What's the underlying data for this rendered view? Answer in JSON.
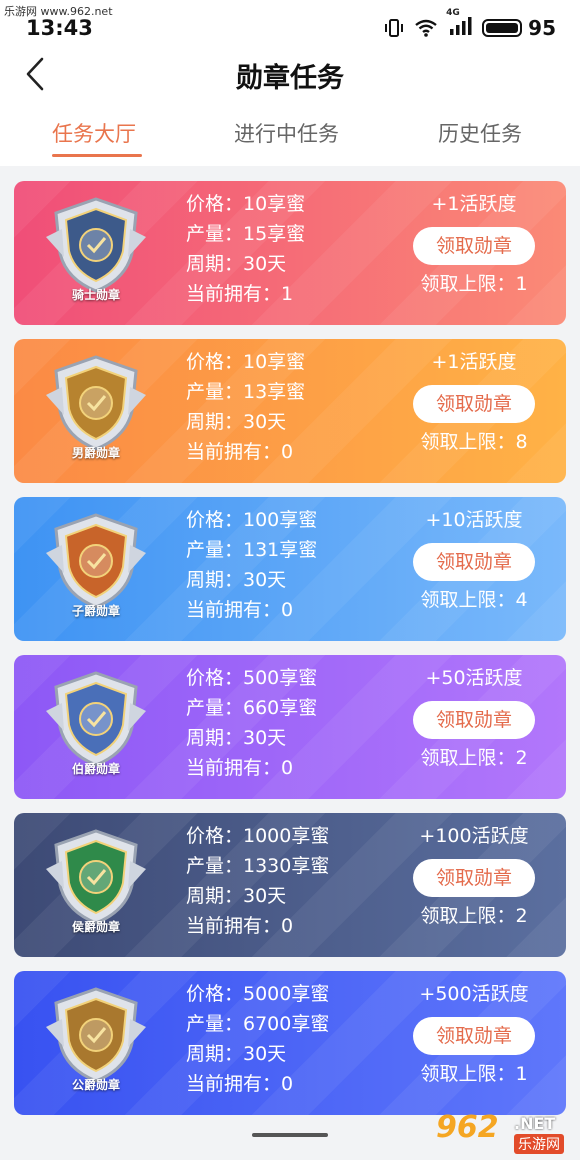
{
  "watermark": {
    "site": "乐游网 www.962.net",
    "logo_num": "962",
    "logo_net": ".NET",
    "logo_cn": "乐游网"
  },
  "status": {
    "time": "13:43",
    "battery": "95",
    "network": "4G"
  },
  "header": {
    "title": "勋章任务"
  },
  "tabs": [
    {
      "label": "任务大厅",
      "active": true
    },
    {
      "label": "进行中任务",
      "active": false
    },
    {
      "label": "历史任务",
      "active": false
    }
  ],
  "medals": [
    {
      "name": "骑士勋章",
      "price": "价格：10享蜜",
      "output": "产量：15享蜜",
      "period": "周期：30天",
      "owned": "当前拥有：1",
      "activity": "+1活跃度",
      "button": "领取勋章",
      "limit": "领取上限：1",
      "colors": [
        "#f04e78",
        "#fb8a76"
      ],
      "shield": "#3d5a8a"
    },
    {
      "name": "男爵勋章",
      "price": "价格：10享蜜",
      "output": "产量：13享蜜",
      "period": "周期：30天",
      "owned": "当前拥有：0",
      "activity": "+1活跃度",
      "button": "领取勋章",
      "limit": "领取上限：8",
      "colors": [
        "#fb8a45",
        "#ffb246"
      ],
      "shield": "#b7832f"
    },
    {
      "name": "子爵勋章",
      "price": "价格：100享蜜",
      "output": "产量：131享蜜",
      "period": "周期：30天",
      "owned": "当前拥有：0",
      "activity": "+10活跃度",
      "button": "领取勋章",
      "limit": "领取上限：4",
      "colors": [
        "#3e93f3",
        "#7ab9fb"
      ],
      "shield": "#c8642a"
    },
    {
      "name": "伯爵勋章",
      "price": "价格：500享蜜",
      "output": "产量：660享蜜",
      "period": "周期：30天",
      "owned": "当前拥有：0",
      "activity": "+50活跃度",
      "button": "领取勋章",
      "limit": "领取上限：2",
      "colors": [
        "#8d58f6",
        "#b277fb"
      ],
      "shield": "#4a6fb8"
    },
    {
      "name": "侯爵勋章",
      "price": "价格：1000享蜜",
      "output": "产量：1330享蜜",
      "period": "周期：30天",
      "owned": "当前拥有：0",
      "activity": "+100活跃度",
      "button": "领取勋章",
      "limit": "领取上限：2",
      "colors": [
        "#3d4a75",
        "#5b6f9f"
      ],
      "shield": "#2f8a4a"
    },
    {
      "name": "公爵勋章",
      "price": "价格：5000享蜜",
      "output": "产量：6700享蜜",
      "period": "周期：30天",
      "owned": "当前拥有：0",
      "activity": "+500活跃度",
      "button": "领取勋章",
      "limit": "领取上限：1",
      "colors": [
        "#3852f1",
        "#5f77fb"
      ],
      "shield": "#a9782e"
    }
  ]
}
